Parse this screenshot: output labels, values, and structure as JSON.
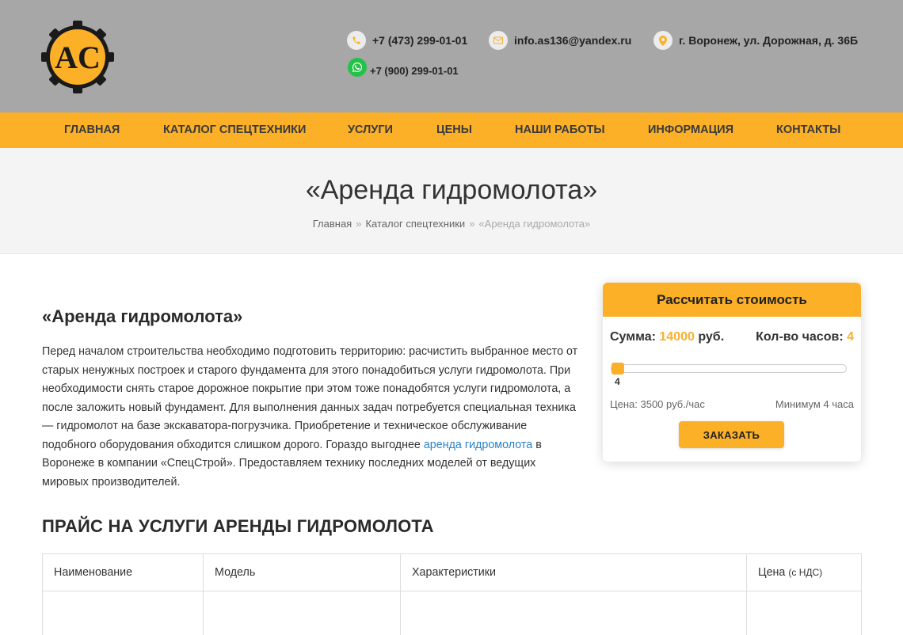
{
  "brand": {
    "logo_text": "AC"
  },
  "contacts": {
    "phone1": "+7 (473) 299-01-01",
    "email": "info.as136@yandex.ru",
    "address": "г. Воронеж, ул. Дорожная, д. 36Б",
    "phone2": "+7 (900) 299-01-01"
  },
  "nav": {
    "items": [
      "Главная",
      "Каталог спецтехники",
      "Услуги",
      "Цены",
      "Наши работы",
      "Информация",
      "Контакты"
    ]
  },
  "page": {
    "title": "«Аренда гидромолота»",
    "breadcrumb": [
      "Главная",
      "Каталог спецтехники",
      "«Аренда гидромолота»"
    ],
    "breadcrumb_sep": "»",
    "heading": "«Аренда гидромолота»",
    "paragraph_before": "Перед началом строительства необходимо подготовить территорию: расчистить выбранное место от старых ненужных построек и старого фундамента для этого понадобиться услуги гидромолота. При необходимости снять старое дорожное покрытие при этом тоже понадобятся услуги гидромолота, а после заложить новый фундамент. Для выполнения данных задач потребуется специальная техника — гидромолот на базе экскаватора-погрузчика. Приобретение и техническое обслуживание подобного оборудования обходится слишком дорого. Гораздо выгоднее ",
    "paragraph_link": "аренда гидромолота",
    "paragraph_after": " в Воронеже в компании «СпецСтрой». Предоставляем технику последних моделей от ведущих мировых производителей.",
    "price_heading": "ПРАЙС НА УСЛУГИ АРЕНДЫ ГИДРОМОЛОТА"
  },
  "table": {
    "headers": [
      "Наименование",
      "Модель",
      "Характеристики",
      "Цена"
    ],
    "price_note": "(с НДС)",
    "rows": [
      [
        "",
        "",
        "",
        ""
      ]
    ]
  },
  "calculator": {
    "title": "Рассчитать стоимость",
    "sum_label": "Сумма:",
    "sum_value": "14000",
    "sum_unit": "руб.",
    "hours_label": "Кол-во часов:",
    "hours_value": "4",
    "slider_value": "4",
    "slider_fraction": 0.0,
    "price_note": "Цена: 3500 руб./час",
    "min_note": "Минимум 4 часа",
    "order_button": "ЗАКАЗАТЬ"
  },
  "colors": {
    "accent": "#fbb028",
    "header_bg": "#a7a7a7",
    "link": "#2a83c7"
  }
}
